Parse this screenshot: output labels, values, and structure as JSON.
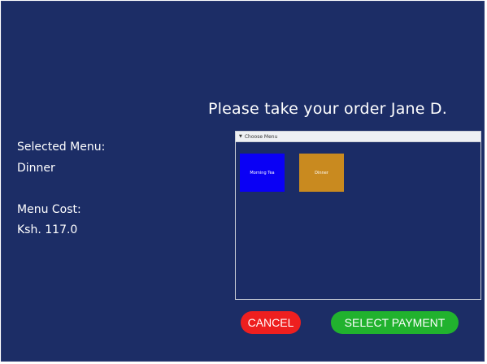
{
  "greeting": "Please take your order Jane D.",
  "selected_menu": {
    "label": "Selected Menu:",
    "value": "Dinner"
  },
  "menu_cost": {
    "label": "Menu Cost:",
    "value": "Ksh. 117.0"
  },
  "menu_panel": {
    "title": "Choose Menu",
    "options": [
      {
        "label": "Morning Tea",
        "color": "#0a00f5"
      },
      {
        "label": "Dinner",
        "color": "#c98a1f"
      }
    ]
  },
  "buttons": {
    "cancel": "CANCEL",
    "select_payment": "SELECT PAYMENT"
  },
  "colors": {
    "background": "#1c2d66",
    "cancel": "#ee1f1f",
    "select_payment": "#21b22e"
  }
}
